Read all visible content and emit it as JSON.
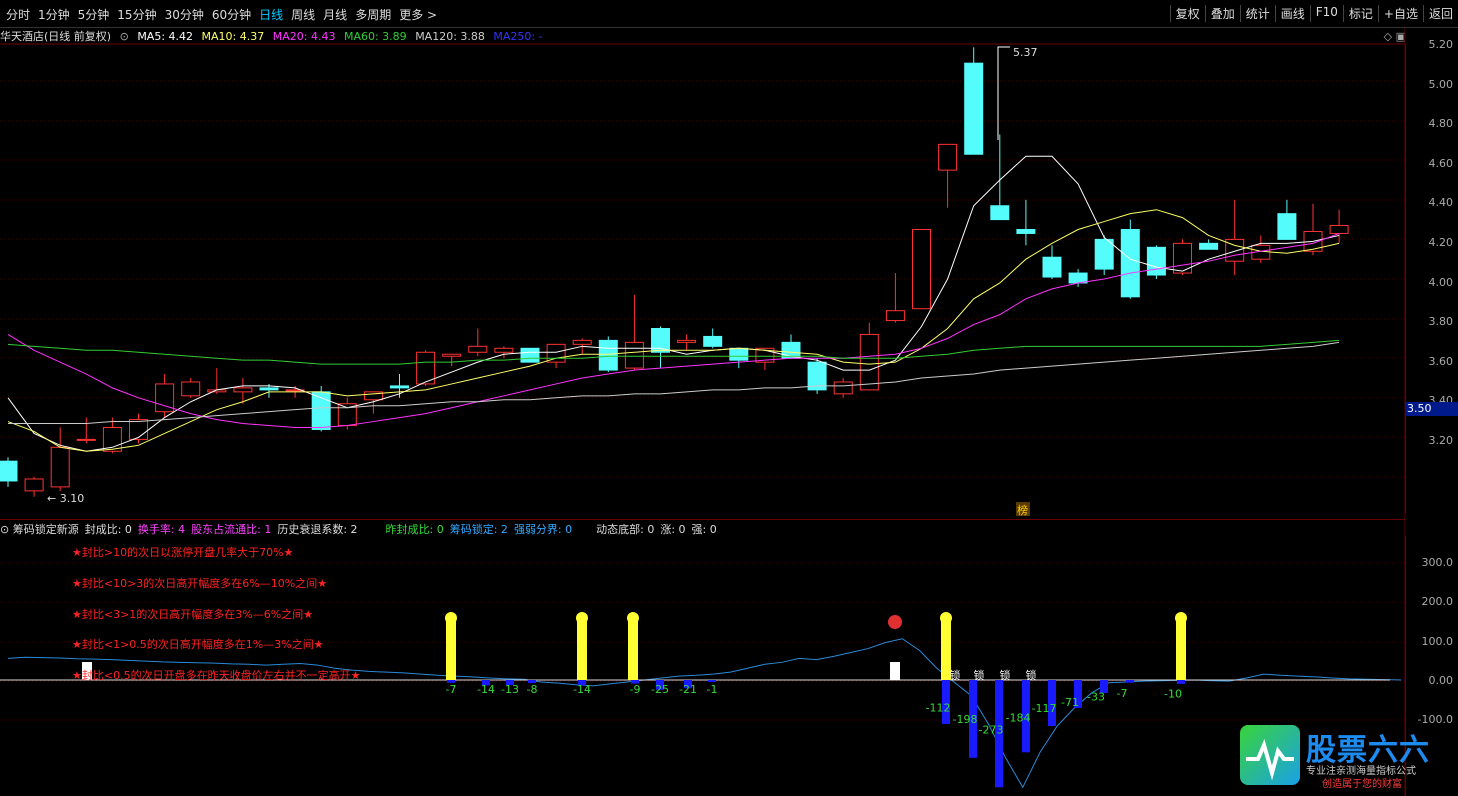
{
  "topbar": {
    "periods": [
      "分时",
      "1分钟",
      "5分钟",
      "15分钟",
      "30分钟",
      "60分钟",
      "日线",
      "周线",
      "月线",
      "多周期",
      "更多 >"
    ],
    "active_period": "日线",
    "tools": [
      "复权",
      "叠加",
      "统计",
      "画线",
      "F10",
      "标记",
      "+自选",
      "返回"
    ]
  },
  "infobar": {
    "stock": "华天酒店(日线 前复权)",
    "ma5": "MA5: 4.42",
    "ma10": "MA10: 4.37",
    "ma20": "MA20: 4.43",
    "ma60": "MA60: 3.89",
    "ma120": "MA120: 3.88",
    "ma250": "MA250: -",
    "corner": "◇ ▣"
  },
  "colors": {
    "up": "#ff3232",
    "down": "#54fcfc",
    "ma5": "#ffffff",
    "ma10": "#ffff66",
    "ma20": "#ff33ff",
    "ma60": "#33cc33",
    "ma120": "#cccccc",
    "ma250": "#3333ff",
    "axis": "#6b0000"
  },
  "price_axis": {
    "ticks": [
      "5.20",
      "5.00",
      "4.80",
      "4.60",
      "4.40",
      "4.20",
      "4.00",
      "3.80",
      "3.60",
      "3.40",
      "3.20"
    ],
    "current": "3.50",
    "high_label": "5.37",
    "low_label": "3.10",
    "marker": "榜"
  },
  "indicator": {
    "header": [
      {
        "text": "筹码锁定新源",
        "color": "#dddddd"
      },
      {
        "text": "封成比: 0",
        "color": "#dddddd"
      },
      {
        "text": "换手率: 4",
        "color": "#ff44ff"
      },
      {
        "text": "股东占流通比: 1",
        "color": "#ff44ff"
      },
      {
        "text": "历史衰退系数: 2",
        "color": "#dddddd"
      },
      {
        "text": "昨封成比: 0",
        "color": "#33dd33"
      },
      {
        "text": "筹码锁定: 2",
        "color": "#33aaff"
      },
      {
        "text": "强弱分界: 0",
        "color": "#33aaff"
      },
      {
        "text": "动态底部: 0",
        "color": "#dddddd"
      },
      {
        "text": "涨: 0",
        "color": "#dddddd"
      },
      {
        "text": "强: 0",
        "color": "#dddddd"
      }
    ],
    "notes": [
      "★封比>10的次日以涨停开盘几率大于70%★",
      "★封比<10>3的次日高开幅度多在6%—10%之间★",
      "★封比<3>1的次日高开幅度多在3%—6%之间★",
      "★封比<1>0.5的次日高开幅度多在1%—3%之间★",
      "★封比<0.5的次日开盘多在昨天收盘价左右并不一定高开★"
    ],
    "ticks": [
      "300.0",
      "200.0",
      "100.0",
      "0.00",
      "-100.0"
    ],
    "values": [
      "-7",
      "-14",
      "-13",
      "-8",
      "-14",
      "-9",
      "-25",
      "-21",
      "-1",
      "-112",
      "-198",
      "-273",
      "-184",
      "-117",
      "-71",
      "-33",
      "-7",
      "-10"
    ],
    "locks": [
      "锁",
      "锁",
      "锁",
      "锁"
    ]
  },
  "logo": {
    "title": "股票六六",
    "sub1": "专业注亲测海量指标公式",
    "sub2": "创造属于您的财富"
  }
}
